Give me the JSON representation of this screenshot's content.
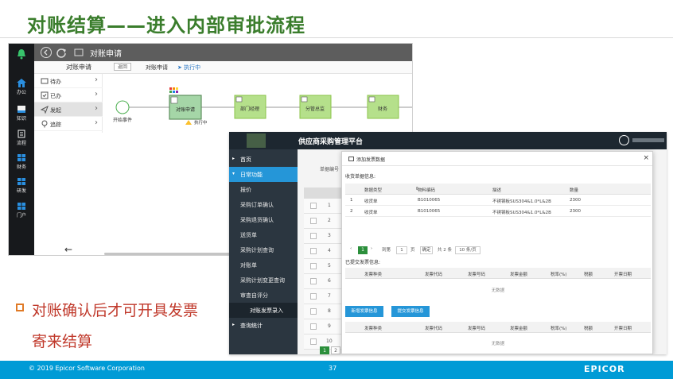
{
  "slide": {
    "title": "对账结算——进入内部审批流程",
    "bullet_line1": "对账确认后才可开具发票",
    "bullet_line2": "寄来结算"
  },
  "footer": {
    "copyright": "© 2019 Epicor Software Corporation",
    "page_number": "37",
    "brand": "EPICOR"
  },
  "workflow_app": {
    "rail_items": [
      {
        "label": "办公",
        "icon": "home-icon"
      },
      {
        "label": "知识",
        "icon": "book-icon"
      },
      {
        "label": "流程",
        "icon": "process-icon"
      },
      {
        "label": "财务",
        "icon": "windows-icon"
      },
      {
        "label": "研发",
        "icon": "windows-icon"
      },
      {
        "label": "门户",
        "icon": "windows-icon"
      }
    ],
    "window_title": "对账申请",
    "sub_left": "对账申请",
    "back_label": "返回",
    "sub_right": "对账申请",
    "exec_label": "执行中",
    "menu": [
      {
        "label": "待办",
        "icon": "inbox-icon"
      },
      {
        "label": "已办",
        "icon": "done-icon"
      },
      {
        "label": "发起",
        "icon": "send-icon"
      },
      {
        "label": "追踪",
        "icon": "track-icon"
      }
    ],
    "flow": {
      "start_label": "开始事件",
      "current_node": "对账申请",
      "current_status": "执行中",
      "nodes": [
        "部门经理",
        "分管总监",
        "财务"
      ]
    }
  },
  "portal_app": {
    "title": "供应商采购管理平台",
    "sidebar": [
      {
        "label": "首页",
        "type": "section"
      },
      {
        "label": "日常功能",
        "type": "active"
      },
      {
        "label": "报价",
        "type": "sub"
      },
      {
        "label": "采购订单确认",
        "type": "sub"
      },
      {
        "label": "采购退货确认",
        "type": "sub"
      },
      {
        "label": "送货单",
        "type": "sub"
      },
      {
        "label": "采购计划查询",
        "type": "sub"
      },
      {
        "label": "对账单",
        "type": "sub"
      },
      {
        "label": "采购计划变更查询",
        "type": "sub"
      },
      {
        "label": "审查自评分",
        "type": "sub"
      },
      {
        "label": "对账发票录入",
        "type": "hilite"
      },
      {
        "label": "查询统计",
        "type": "section"
      }
    ],
    "bg_form_label": "单据编号",
    "bg_rows": [
      "1",
      "2",
      "3",
      "4",
      "5",
      "6",
      "7",
      "8",
      "9",
      "10"
    ],
    "bg_pages": [
      "1",
      "2"
    ],
    "modal": {
      "title": "添加发票数据",
      "section1": "收货单据信息:",
      "table1_headers": [
        "数据类型",
        "物料编码",
        "描述",
        "数量"
      ],
      "table1_rows": [
        [
          "1",
          "收货单",
          "B1010065",
          "不锈钢板SUS304&1.0*L&2B",
          "2300"
        ],
        [
          "2",
          "收货单",
          "B1010065",
          "不锈钢板SUS304&1.0*L&2B",
          "2300"
        ]
      ],
      "pager": {
        "current": "1",
        "goto_label": "到第",
        "page_input": "1",
        "page_unit": "页",
        "confirm": "确定",
        "total": "共 2 条",
        "page_size": "10 条/页"
      },
      "section2": "已提交发票信息:",
      "invoice_headers": [
        "发票种类",
        "发票代码",
        "发票号码",
        "发票金额",
        "税率(%)",
        "税额",
        "开票日期"
      ],
      "empty_text": "无数据",
      "btn_add": "新增发票信息",
      "btn_submit": "提交发票信息"
    }
  }
}
